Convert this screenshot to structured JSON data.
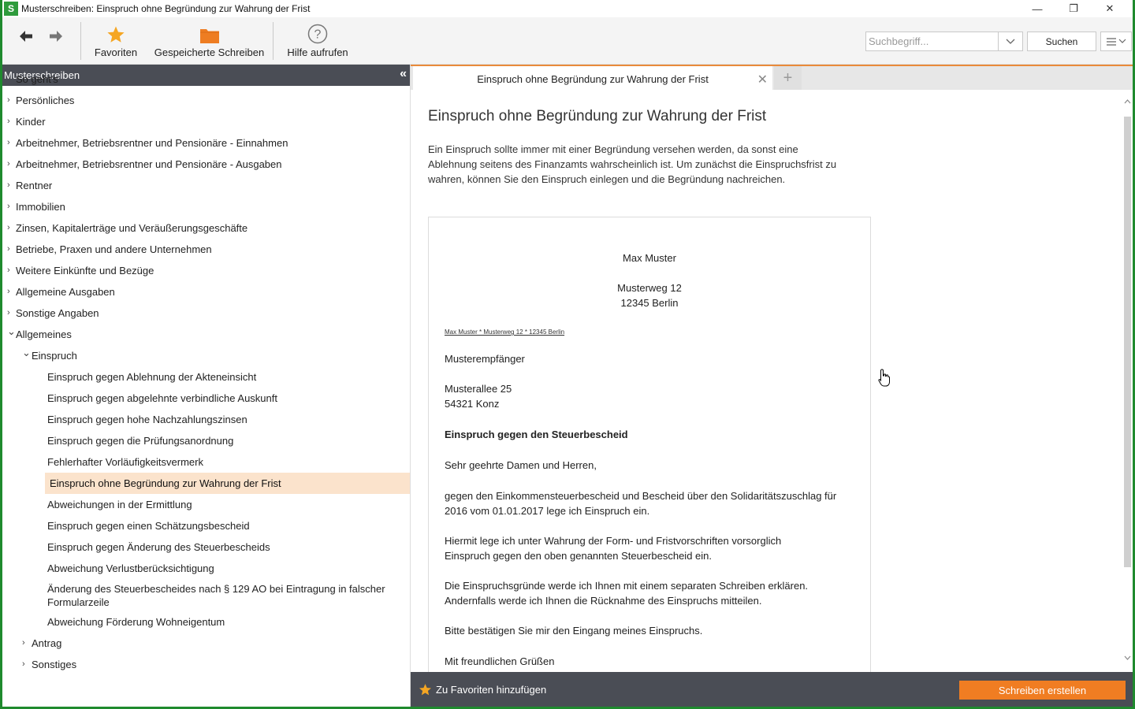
{
  "window": {
    "app_icon_letter": "S",
    "title": "Musterschreiben: Einspruch ohne Begründung zur Wahrung der Frist",
    "minimize": "—",
    "restore": "❐",
    "close": "✕"
  },
  "toolbar": {
    "back_icon": "arrow-left-icon",
    "forward_icon": "arrow-right-icon",
    "favorites_label": "Favoriten",
    "saved_label": "Gespeicherte Schreiben",
    "help_label": "Hilfe aufrufen",
    "search_placeholder": "Suchbegriff...",
    "search_button": "Suchen",
    "colors": {
      "star": "#f5a623",
      "folder": "#ee7d22"
    }
  },
  "sidebar": {
    "header": "Musterschreiben",
    "collapse": "«",
    "items": [
      {
        "label": "So geht's",
        "level": 0,
        "chevron": ""
      },
      {
        "label": "Persönliches",
        "level": 0,
        "chevron": "›"
      },
      {
        "label": "Kinder",
        "level": 0,
        "chevron": "›"
      },
      {
        "label": "Arbeitnehmer, Betriebsrentner und Pensionäre - Einnahmen",
        "level": 0,
        "chevron": "›"
      },
      {
        "label": "Arbeitnehmer, Betriebsrentner und Pensionäre - Ausgaben",
        "level": 0,
        "chevron": "›"
      },
      {
        "label": "Rentner",
        "level": 0,
        "chevron": "›"
      },
      {
        "label": "Immobilien",
        "level": 0,
        "chevron": "›"
      },
      {
        "label": "Zinsen, Kapitalerträge und Veräußerungsgeschäfte",
        "level": 0,
        "chevron": "›"
      },
      {
        "label": "Betriebe, Praxen und andere Unternehmen",
        "level": 0,
        "chevron": "›"
      },
      {
        "label": "Weitere Einkünfte und Bezüge",
        "level": 0,
        "chevron": "›"
      },
      {
        "label": "Allgemeine Ausgaben",
        "level": 0,
        "chevron": "›"
      },
      {
        "label": "Sonstige Angaben",
        "level": 0,
        "chevron": "›"
      },
      {
        "label": "Allgemeines",
        "level": 0,
        "chevron": "⌄"
      },
      {
        "label": "Einspruch",
        "level": 1,
        "chevron": "⌄"
      },
      {
        "label": "Einspruch gegen Ablehnung der Akteneinsicht",
        "level": 2,
        "chevron": ""
      },
      {
        "label": "Einspruch gegen abgelehnte verbindliche Auskunft",
        "level": 2,
        "chevron": ""
      },
      {
        "label": "Einspruch gegen hohe Nachzahlungszinsen",
        "level": 2,
        "chevron": ""
      },
      {
        "label": "Einspruch gegen die Prüfungsanordnung",
        "level": 2,
        "chevron": ""
      },
      {
        "label": "Fehlerhafter Vorläufigkeitsvermerk",
        "level": 2,
        "chevron": ""
      },
      {
        "label": "Einspruch ohne Begründung zur Wahrung der Frist",
        "level": 2,
        "chevron": "",
        "selected": true
      },
      {
        "label": "Abweichungen in der Ermittlung",
        "level": 2,
        "chevron": ""
      },
      {
        "label": "Einspruch gegen einen Schätzungsbescheid",
        "level": 2,
        "chevron": ""
      },
      {
        "label": "Einspruch gegen Änderung des Steuerbescheids",
        "level": 2,
        "chevron": ""
      },
      {
        "label": "Abweichung Verlustberücksichtigung",
        "level": 2,
        "chevron": ""
      },
      {
        "label": "Änderung des Steuerbescheides nach § 129 AO bei Eintragung in falscher Formularzeile",
        "level": 2,
        "chevron": ""
      },
      {
        "label": "Abweichung Förderung Wohneigentum",
        "level": 2,
        "chevron": ""
      },
      {
        "label": "Antrag",
        "level": 1,
        "chevron": "›"
      },
      {
        "label": "Sonstiges",
        "level": 1,
        "chevron": "›"
      }
    ]
  },
  "tabs": {
    "active_label": "Einspruch ohne Begründung zur Wahrung der Frist",
    "close": "✕",
    "add": "+"
  },
  "content": {
    "title": "Einspruch ohne Begründung zur Wahrung der Frist",
    "intro": "Ein Einspruch sollte immer mit einer Begründung versehen werden, da sonst eine Ablehnung seitens des Finanzamts wahrscheinlich ist. Um zunächst die Einspruchsfrist zu wahren, können Sie den Einspruch einlegen und die Begründung nachreichen."
  },
  "letter": {
    "sender_name": "Max Muster",
    "sender_street": "Musterweg 12",
    "sender_city": "12345 Berlin",
    "sender_line": "Max Muster * Musterweg 12 * 12345 Berlin",
    "recipient_name": "Musterempfänger",
    "recipient_street": "Musterallee 25",
    "recipient_city": "54321 Konz",
    "subject": "Einspruch gegen den Steuerbescheid",
    "salutation": "Sehr geehrte Damen und Herren,",
    "para1_line1": "gegen den Einkommensteuerbescheid und Bescheid über den Solidaritätszuschlag für",
    "para1_line2": "2016 vom 01.01.2017 lege ich Einspruch ein.",
    "para2_line1": "Hiermit lege ich unter Wahrung der Form- und Fristvorschriften vorsorglich",
    "para2_line2": "Einspruch gegen den oben genannten Steuerbescheid ein.",
    "para3_line1": "Die Einspruchsgründe werde ich Ihnen mit einem separaten Schreiben erklären.",
    "para3_line2": "Andernfalls werde ich Ihnen die Rücknahme des Einspruchs mitteilen.",
    "para4": "Bitte bestätigen Sie mir den Eingang meines Einspruchs.",
    "closing": "Mit freundlichen Grüßen"
  },
  "bottom": {
    "add_favorite": "Zu Favoriten hinzufügen",
    "create_letter": "Schreiben erstellen"
  }
}
